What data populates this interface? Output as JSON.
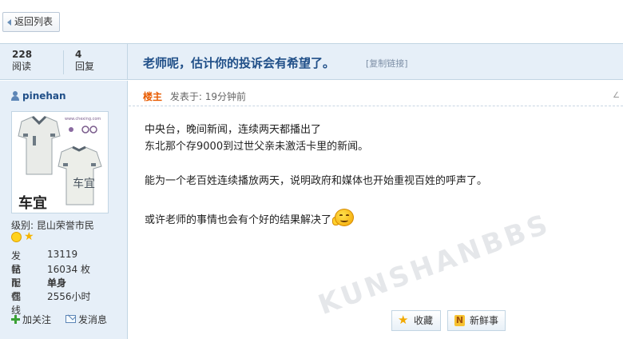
{
  "toolbar": {
    "back_label": "返回列表"
  },
  "thread": {
    "views": "228",
    "views_label": "阅读",
    "replies": "4",
    "replies_label": "回复",
    "title": "老师呢，估计你的投诉会有希望了。",
    "copy_link": "[复制链接]"
  },
  "author": {
    "username": "pinehan",
    "level_label": "级别:",
    "level_value": "昆山荣誉市民",
    "stats": [
      {
        "key": "发帖",
        "value": "13119"
      },
      {
        "key": "昆币",
        "value": "16034 枚"
      },
      {
        "key": "配偶",
        "value": "单身"
      },
      {
        "key": "在线",
        "value": "2556小时"
      }
    ],
    "follow_label": "加关注",
    "message_label": "发消息"
  },
  "post": {
    "badge": "楼主",
    "time": "发表于: 19分钟前",
    "corner": "∠",
    "paragraphs": [
      "中央台，晚间新闻，连续两天都播出了",
      "东北那个存9000到过世父亲未激活卡里的新闻。",
      "能为一个老百姓连续播放两天，说明政府和媒体也开始重视百姓的呼声了。",
      "或许老师的事情也会有个好的结果解决了"
    ],
    "emoji": "smile-wave-icon",
    "fav_label": "收藏",
    "news_label": "新鲜事",
    "watermark": "KUNSHANBBS"
  },
  "colors": {
    "accent": "#204f88",
    "sidebar_bg": "#e6eff8",
    "border": "#c2d5e3",
    "op_badge": "#e85b00"
  }
}
